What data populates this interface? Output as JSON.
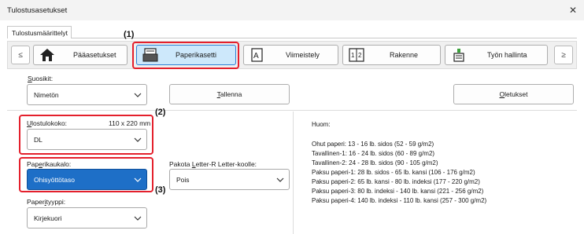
{
  "window": {
    "title": "Tulostusasetukset",
    "close_glyph": "✕"
  },
  "tabs": [
    {
      "label": "Tulostusmäärittelyt"
    }
  ],
  "toolbar": {
    "prev_glyph": "≤",
    "next_glyph": "≥",
    "buttons": [
      {
        "label": "Pääasetukset",
        "icon": "home-icon"
      },
      {
        "label": "Paperikasetti",
        "icon": "paper-tray-icon"
      },
      {
        "label": "Viimeistely",
        "icon": "finishing-icon"
      },
      {
        "label": "Rakenne",
        "icon": "layout-icon"
      },
      {
        "label": "Työn hallinta",
        "icon": "job-stack-icon"
      }
    ]
  },
  "callouts": {
    "c1": "(1)",
    "c2": "(2)",
    "c3": "(3)"
  },
  "favorites": {
    "label_prefix": "",
    "label_u": "S",
    "label_rest": "uosikit:",
    "value": "Nimetön",
    "save_u": "T",
    "save_rest": "allenna",
    "defaults_u": "O",
    "defaults_rest": "letukset"
  },
  "output_size": {
    "label_u": "U",
    "label_rest": "lostulokoko:",
    "dimensions": "110 x 220 mm",
    "value": "DL"
  },
  "paper_source": {
    "label_pre": "Pap",
    "label_u": "e",
    "label_rest": "rikaukalo:",
    "value": "Ohisyöttötaso"
  },
  "paper_type": {
    "label_pre": "Paper",
    "label_u": "i",
    "label_rest": "tyyppi:",
    "value": "Kirjekuori"
  },
  "force_letter": {
    "label_pre": "Pakota ",
    "label_u": "L",
    "label_rest": "etter-R Letter-koolle:",
    "value": "Pois"
  },
  "notes": {
    "title": "Huom:",
    "lines": [
      "Ohut paperi: 13 - 16 lb. sidos (52 - 59 g/m2)",
      "Tavallinen-1: 16 - 24 lb. sidos (60 - 89 g/m2)",
      "Tavallinen-2: 24 - 28 lb. sidos (90 - 105 g/m2)",
      "Paksu paperi-1: 28 lb. sidos - 65 lb. kansi (106 - 176 g/m2)",
      "Paksu paperi-2: 65 lb. kansi - 80 lb. indeksi (177 - 220 g/m2)",
      "Paksu paperi-3: 80 lb. indeksi - 140 lb. kansi (221 - 256 g/m2)",
      "Paksu paperi-4: 140 lb. indeksi - 110 lb. kansi (257 - 300 g/m2)"
    ]
  },
  "colors": {
    "highlight_red": "#e4202c",
    "selected_blue": "#1e6fc7"
  }
}
